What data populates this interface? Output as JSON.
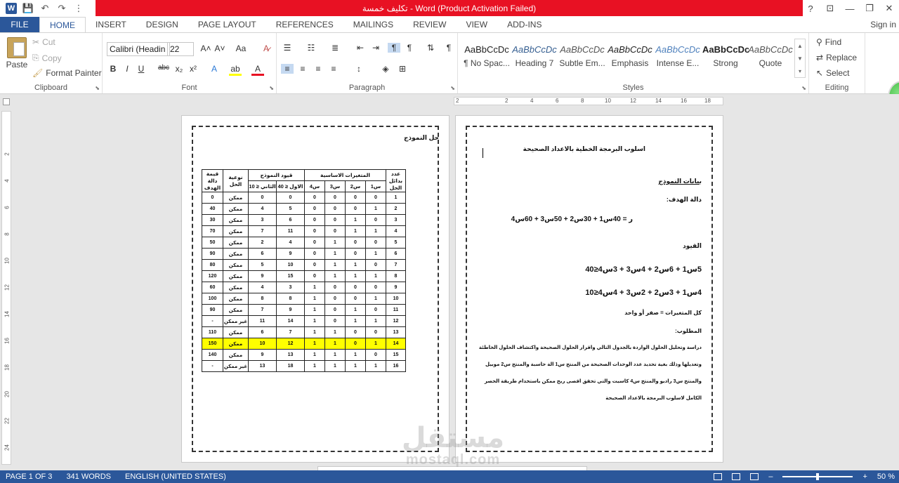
{
  "window": {
    "title": "تكليف خمسة - Word (Product Activation Failed)",
    "title_bar_color": "#e81123",
    "help": "?",
    "min": "—",
    "max": "❐",
    "close": "✕",
    "restore_icon": "⊡"
  },
  "qat": {
    "word": "W",
    "save": "💾",
    "undo": "↶",
    "redo": "↷",
    "more": "⋮"
  },
  "tabs": [
    "FILE",
    "HOME",
    "INSERT",
    "DESIGN",
    "PAGE LAYOUT",
    "REFERENCES",
    "MAILINGS",
    "REVIEW",
    "VIEW",
    "ADD-INS"
  ],
  "sign_in": "Sign in",
  "ribbon": {
    "clipboard": {
      "label": "Clipboard",
      "paste": "Paste",
      "cut": "Cut",
      "copy": "Copy",
      "format_painter": "Format Painter"
    },
    "font": {
      "label": "Font",
      "font_name": "Calibri (Headin",
      "font_size": "22",
      "grow": "A˄",
      "shrink": "A˅",
      "case": "Aa",
      "clear": "A̷",
      "bold": "B",
      "italic": "I",
      "underline": "U",
      "strike": "abc",
      "sub": "x₂",
      "sup": "x²",
      "effects": "A",
      "highlight": "ab",
      "color": "A"
    },
    "paragraph": {
      "label": "Paragraph"
    },
    "styles": {
      "label": "Styles",
      "items": [
        {
          "preview": "AaBbCcDc",
          "name": "¶ No Spac..."
        },
        {
          "preview": "AaBbCcDc",
          "name": "Heading 7"
        },
        {
          "preview": "AaBbCcDc",
          "name": "Subtle Em..."
        },
        {
          "preview": "AaBbCcDc",
          "name": "Emphasis"
        },
        {
          "preview": "AaBbCcDc",
          "name": "Intense E..."
        },
        {
          "preview": "AaBbCcDc",
          "name": "Strong"
        },
        {
          "preview": "AaBbCcDc",
          "name": "Quote"
        }
      ]
    },
    "editing": {
      "label": "Editing",
      "find": "Find",
      "replace": "Replace",
      "select": "Select"
    }
  },
  "ruler": {
    "h_ticks": [
      "2",
      "2",
      "4",
      "6",
      "8",
      "10",
      "12",
      "14",
      "16",
      "18"
    ],
    "v_ticks": [
      "2",
      "4",
      "6",
      "8",
      "10",
      "12",
      "14",
      "16",
      "18",
      "20",
      "22",
      "24"
    ]
  },
  "left_page": {
    "title": "حل النموذج",
    "headers": {
      "count": "عدد بدائل الحل",
      "vars": "المتغيرات الاساسية",
      "constraints": "قيود النموذج",
      "type": "نوعية الحل",
      "value": "قيمة دالة الهدف",
      "s1": "س1",
      "s2": "س2",
      "s3": "س3",
      "s4": "س4",
      "c1": "الاول ≤ 40",
      "c2": "الثاني ≤ 10"
    },
    "rows": [
      [
        "1",
        "0",
        "0",
        "0",
        "0",
        "0",
        "0",
        "ممكن",
        "0"
      ],
      [
        "2",
        "1",
        "0",
        "0",
        "0",
        "5",
        "4",
        "ممكن",
        "40"
      ],
      [
        "3",
        "0",
        "1",
        "0",
        "0",
        "6",
        "3",
        "ممكن",
        "30"
      ],
      [
        "4",
        "1",
        "1",
        "0",
        "0",
        "11",
        "7",
        "ممكن",
        "70"
      ],
      [
        "5",
        "0",
        "0",
        "1",
        "0",
        "4",
        "2",
        "ممكن",
        "50"
      ],
      [
        "6",
        "1",
        "0",
        "1",
        "0",
        "9",
        "6",
        "ممكن",
        "90"
      ],
      [
        "7",
        "0",
        "1",
        "1",
        "0",
        "10",
        "5",
        "ممكن",
        "80"
      ],
      [
        "8",
        "1",
        "1",
        "1",
        "0",
        "15",
        "9",
        "ممكن",
        "120"
      ],
      [
        "9",
        "0",
        "0",
        "0",
        "1",
        "3",
        "4",
        "ممكن",
        "60"
      ],
      [
        "10",
        "1",
        "0",
        "0",
        "1",
        "8",
        "8",
        "ممكن",
        "100"
      ],
      [
        "11",
        "0",
        "1",
        "0",
        "1",
        "9",
        "7",
        "ممكن",
        "90"
      ],
      [
        "12",
        "1",
        "1",
        "0",
        "1",
        "14",
        "11",
        "غير ممكن",
        "-"
      ],
      [
        "13",
        "0",
        "0",
        "1",
        "1",
        "7",
        "6",
        "ممكن",
        "110"
      ],
      [
        "14",
        "1",
        "0",
        "1",
        "1",
        "12",
        "10",
        "ممكن",
        "150"
      ],
      [
        "15",
        "0",
        "1",
        "1",
        "1",
        "13",
        "9",
        "ممكن",
        "140"
      ],
      [
        "16",
        "1",
        "1",
        "1",
        "1",
        "18",
        "13",
        "غير ممكن",
        "-"
      ]
    ],
    "highlight_row": 14,
    "highlight_color": "#ffff00"
  },
  "right_page": {
    "title": "اسلوب البرمجة الخطية بالاعداد الصحيحة",
    "data_heading": "بيانات النموذج",
    "objective_label": "دالة الهدف:",
    "objective": "ر = 40س1 + 30س2 + 50س3 + 60س4",
    "constraints_label": "القيود",
    "c1": "5س1 + 6س2 + 4س3 + 3س4≤40",
    "c2": "4س1 + 3س2 + 2س3 + 4س4≤10",
    "all_vars": "كل المتغيرات = صفر أو واحد",
    "required_label": "المطلوب:",
    "req1": "دراسة وتحليل الحلول الواردة بالجدول التالي واقرار الحلول الصحيحة واكتشاف الحلول الخاطئة",
    "req2": "وتعديلها وذلك بغية تحديد عدد الوحدات الصحيحة من المنتج س1 الة حاسبة والمنتج س2 موبيل",
    "req3": "والمنتج س3 راديو والمنتج س4 كاسيت والتي تحقق اقصى ربح ممكن باستخدام طريقة الحصر",
    "req4": "الكامل لاسلوب البرمجة بالاعداد الصحيحة"
  },
  "watermark": {
    "ar": "مستقل",
    "en": "mostaql.com"
  },
  "status": {
    "page": "PAGE 1 OF 3",
    "words": "341 WORDS",
    "lang": "ENGLISH (UNITED STATES)",
    "zoom": "50 %",
    "minus": "–",
    "plus": "+"
  },
  "colors": {
    "accent": "#2b579a",
    "status_bar": "#2b579a"
  }
}
